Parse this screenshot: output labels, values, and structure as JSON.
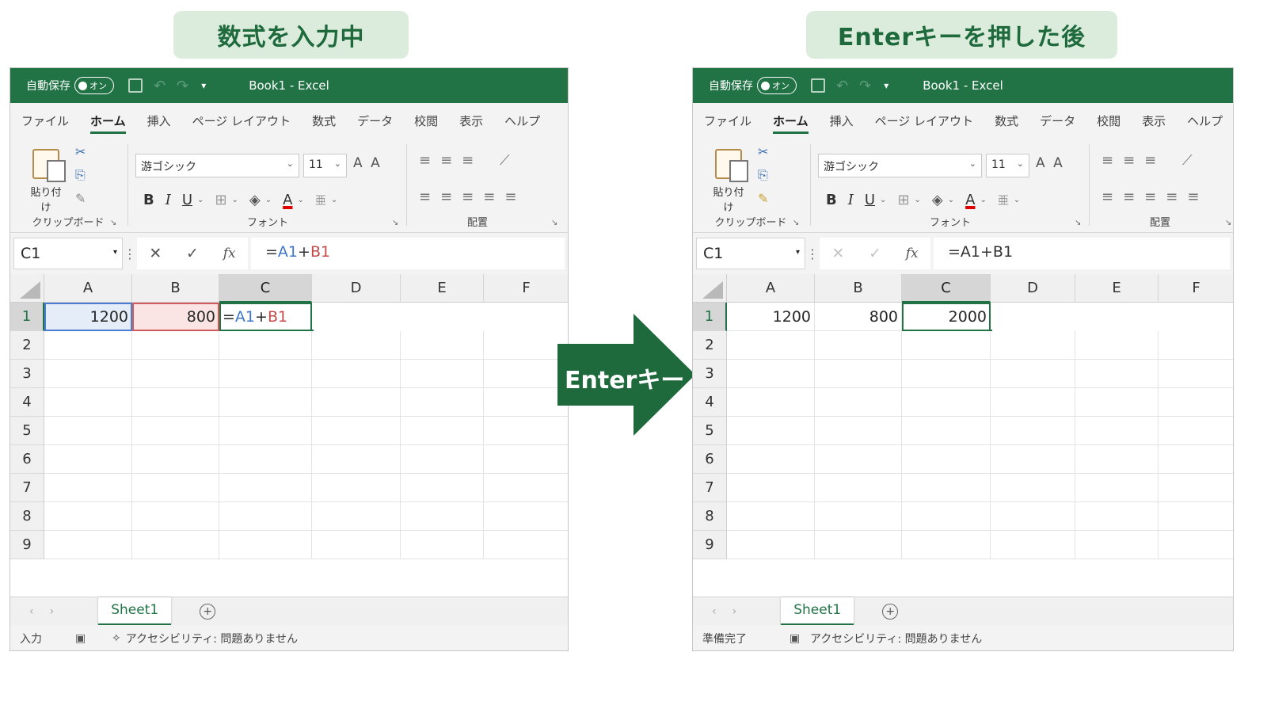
{
  "captions": {
    "left": "数式を入力中",
    "right": "Enterキーを押した後",
    "arrow": "Enterキー"
  },
  "colors": {
    "excel_green": "#217346",
    "caption_bg": "#dcecdc",
    "ref_blue": "#3f76c9",
    "ref_red": "#c44b4b"
  },
  "window": {
    "autosave": "自動保存",
    "toggle": "オン",
    "title": "Book1  -  Excel",
    "menu": [
      "ファイル",
      "ホーム",
      "挿入",
      "ページ レイアウト",
      "数式",
      "データ",
      "校閲",
      "表示",
      "ヘルプ"
    ],
    "ribbon": {
      "paste": "貼り付け",
      "clipboard_group": "クリップボード",
      "font_name": "游ゴシック",
      "font_size": "11",
      "font_group": "フォント",
      "align_group": "配置",
      "bold": "B",
      "italic": "I",
      "underline": "U",
      "font_color": "A"
    },
    "namebox": "C1",
    "formula": "=A1+B1",
    "fx": "fx",
    "columns": [
      "A",
      "B",
      "C",
      "D",
      "E",
      "F"
    ],
    "rows": [
      "1",
      "2",
      "3",
      "4",
      "5",
      "6",
      "7",
      "8",
      "9"
    ],
    "sheet_tab": "Sheet1",
    "accessibility": "アクセシビリティ: 問題ありません"
  },
  "left": {
    "status": "入力",
    "cells": {
      "A1": "1200",
      "B1": "800",
      "C1_eq": "=",
      "C1_a": "A1",
      "C1_plus": "+",
      "C1_b": "B1"
    },
    "formula_eq": "=",
    "formula_a": "A1",
    "formula_plus": "+",
    "formula_b": "B1"
  },
  "right": {
    "status": "準備完了",
    "cells": {
      "A1": "1200",
      "B1": "800",
      "C1": "2000"
    }
  }
}
